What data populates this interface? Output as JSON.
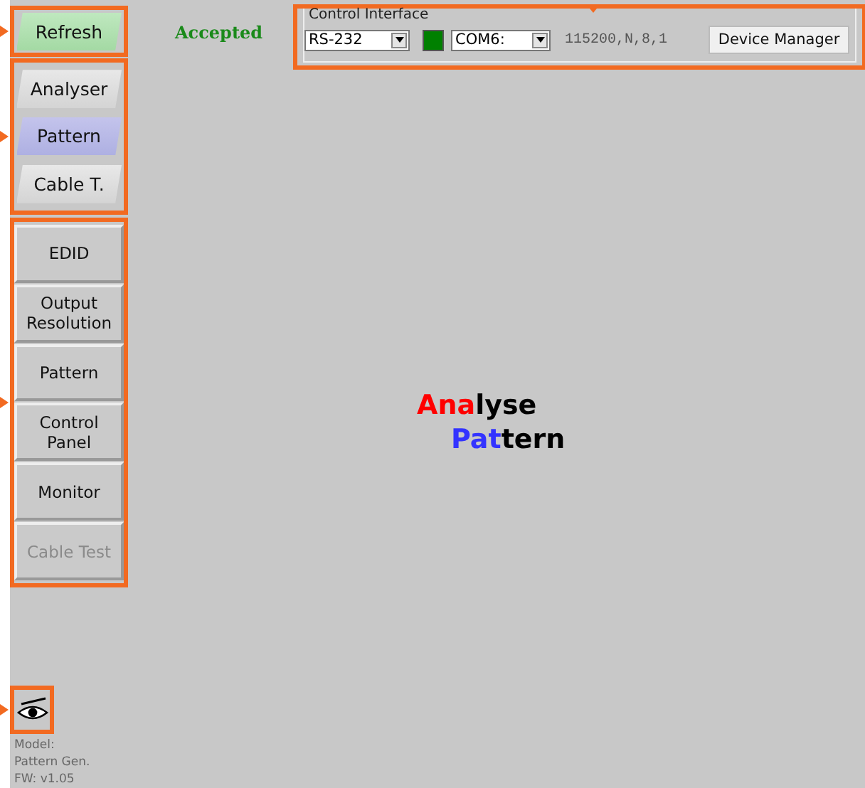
{
  "refresh_button": {
    "label": "Refresh",
    "highlighted": true
  },
  "status": "Accepted",
  "control_interface": {
    "highlighted": true,
    "title": "Control Interface",
    "port_type": "RS-232",
    "connected": true,
    "port": "COM6:",
    "settings": "115200,N,8,1",
    "button": "Device Manager"
  },
  "nav": {
    "highlighted": true,
    "items": [
      {
        "label": "Analyser",
        "selected": false
      },
      {
        "label": "Pattern",
        "selected": true
      },
      {
        "label": "Cable T.",
        "selected": false
      }
    ]
  },
  "menu": {
    "highlighted": true,
    "items": [
      {
        "label": "EDID",
        "disabled": false
      },
      {
        "label": "Output Resolution",
        "disabled": false
      },
      {
        "label": "Pattern",
        "disabled": false
      },
      {
        "label": "Control Panel",
        "disabled": false
      },
      {
        "label": "Monitor",
        "disabled": false
      },
      {
        "label": "Cable Test",
        "disabled": true
      }
    ]
  },
  "logo": [
    [
      {
        "text": "Ana",
        "color": "#ff0000"
      },
      {
        "text": "lyse",
        "color": "#000000"
      }
    ],
    [
      {
        "text": "Pat",
        "color": "#3333ff"
      },
      {
        "text": "tern",
        "color": "#000000"
      }
    ]
  ],
  "eye_button": {
    "highlighted": true
  },
  "device_info": [
    "Model:",
    "Pattern Gen.",
    "FW: v1.05"
  ]
}
